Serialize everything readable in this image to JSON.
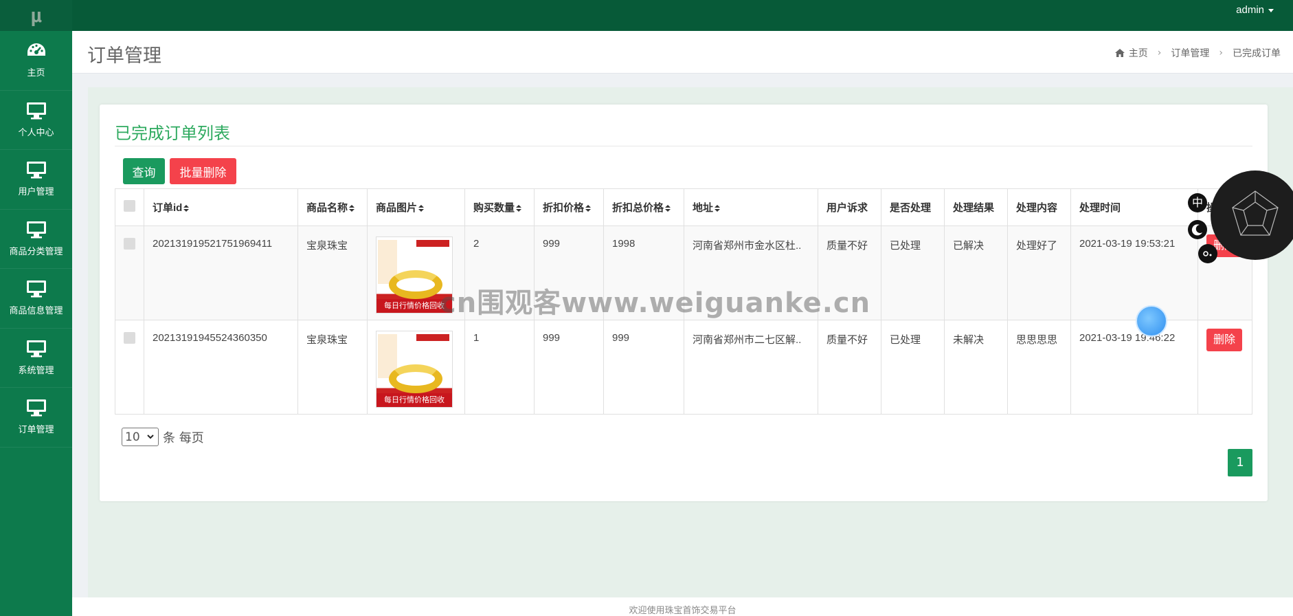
{
  "app": {
    "logo": "μ",
    "user": "admin"
  },
  "sidebar": {
    "items": [
      {
        "label": "主页",
        "icon": "dashboard-icon"
      },
      {
        "label": "个人中心",
        "icon": "monitor-icon"
      },
      {
        "label": "用户管理",
        "icon": "monitor-icon"
      },
      {
        "label": "商品分类管理",
        "icon": "monitor-icon"
      },
      {
        "label": "商品信息管理",
        "icon": "monitor-icon"
      },
      {
        "label": "系统管理",
        "icon": "monitor-icon"
      },
      {
        "label": "订单管理",
        "icon": "monitor-icon"
      }
    ]
  },
  "header": {
    "title": "订单管理",
    "breadcrumb": [
      "主页",
      "订单管理",
      "已完成订单"
    ]
  },
  "card": {
    "title": "已完成订单列表",
    "query_label": "查询",
    "batch_delete_label": "批量删除"
  },
  "table": {
    "columns": [
      "订单id",
      "商品名称",
      "商品图片",
      "购买数量",
      "折扣价格",
      "折扣总价格",
      "地址",
      "用户诉求",
      "是否处理",
      "处理结果",
      "处理内容",
      "处理时间",
      "操作"
    ],
    "rows": [
      {
        "order_id": "20213191952175196941​1",
        "name": "宝泉珠宝",
        "image_caption": "每日行情价格回收",
        "qty": "2",
        "price": "999",
        "total": "1998",
        "address": "河南省郑州市金水区杜..",
        "appeal": "质量不好",
        "handled": "已处理",
        "result": "已解决",
        "content": "处理好了",
        "time": "2021-03-19 19:53:21",
        "delete_label": "删除"
      },
      {
        "order_id": "20213191945524360350",
        "name": "宝泉珠宝",
        "image_caption": "每日行情价格回收",
        "qty": "1",
        "price": "999",
        "total": "999",
        "address": "河南省郑州市二七区解..",
        "appeal": "质量不好",
        "handled": "已处理",
        "result": "未解决",
        "content": "思思思思",
        "time": "2021-03-19 19:46:22",
        "delete_label": "删除"
      }
    ]
  },
  "pager": {
    "page_size": "10",
    "per_page_label": "条 每页",
    "current_page": "1"
  },
  "footer": {
    "text": "欢迎使用珠宝首饰交易平台"
  },
  "overlay": {
    "watermark": "cn围观客www.weiguanke.cn",
    "lang_button": "中"
  },
  "colors": {
    "sidebar": "#0d7a4c",
    "topbar": "#075a38",
    "accent": "#1a9a5e",
    "danger": "#f4424b",
    "title_green": "#2eaa5f"
  }
}
